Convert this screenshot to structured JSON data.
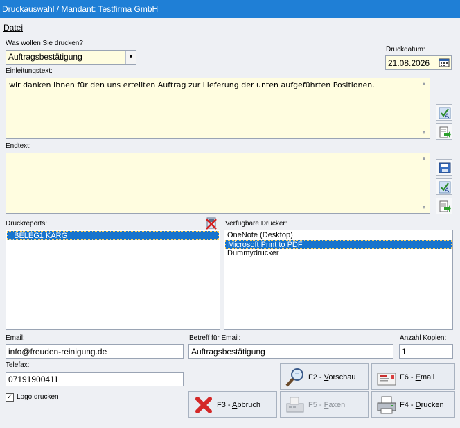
{
  "window": {
    "title": "Druckauswahl / Mandant: Testfirma GmbH"
  },
  "menu": {
    "items": [
      {
        "label": "Datei"
      }
    ]
  },
  "print_what": {
    "label": "Was wollen Sie drucken?",
    "value": "Auftragsbestätigung"
  },
  "print_date": {
    "label": "Druckdatum:",
    "value": "21.08.2026"
  },
  "intro_text": {
    "label": "Einleitungstext:",
    "value": "wir danken Ihnen für den uns erteilten Auftrag zur Lieferung der unten aufgeführten Positionen."
  },
  "end_text": {
    "label": "Endtext:",
    "value": ""
  },
  "reports": {
    "label": "Druckreports:",
    "items": [
      {
        "label": "_BELEG1   KARG",
        "selected": true
      }
    ]
  },
  "printers": {
    "label": "Verfügbare Drucker:",
    "items": [
      {
        "label": "OneNote (Desktop)",
        "selected": false
      },
      {
        "label": "Microsoft Print to PDF",
        "selected": true
      },
      {
        "label": "Dummydrucker",
        "selected": false
      }
    ]
  },
  "email": {
    "label": "Email:",
    "value": "info@freuden-reinigung.de"
  },
  "subject": {
    "label": "Betreff für Email:",
    "value": "Auftragsbestätigung"
  },
  "copies": {
    "label": "Anzahl Kopien:",
    "value": "1"
  },
  "fax": {
    "label": "Telefax:",
    "value": "07191900411"
  },
  "logo": {
    "label": "Logo drucken",
    "checked": true
  },
  "buttons": {
    "preview": {
      "prefix": "F2 - ",
      "key": "V",
      "rest": "orschau"
    },
    "email": {
      "prefix": "F6 - ",
      "key": "E",
      "rest": "mail"
    },
    "cancel": {
      "prefix": "F3 - ",
      "key": "A",
      "rest": "bbruch"
    },
    "fax": {
      "prefix": "F5 - ",
      "key": "F",
      "rest": "axen",
      "disabled": true
    },
    "print": {
      "prefix": "F4 - ",
      "key": "D",
      "rest": "rucken"
    }
  },
  "colors": {
    "title_bar": "#1f7fd6",
    "field_bg": "#fffde0",
    "selection": "#1874cd"
  }
}
